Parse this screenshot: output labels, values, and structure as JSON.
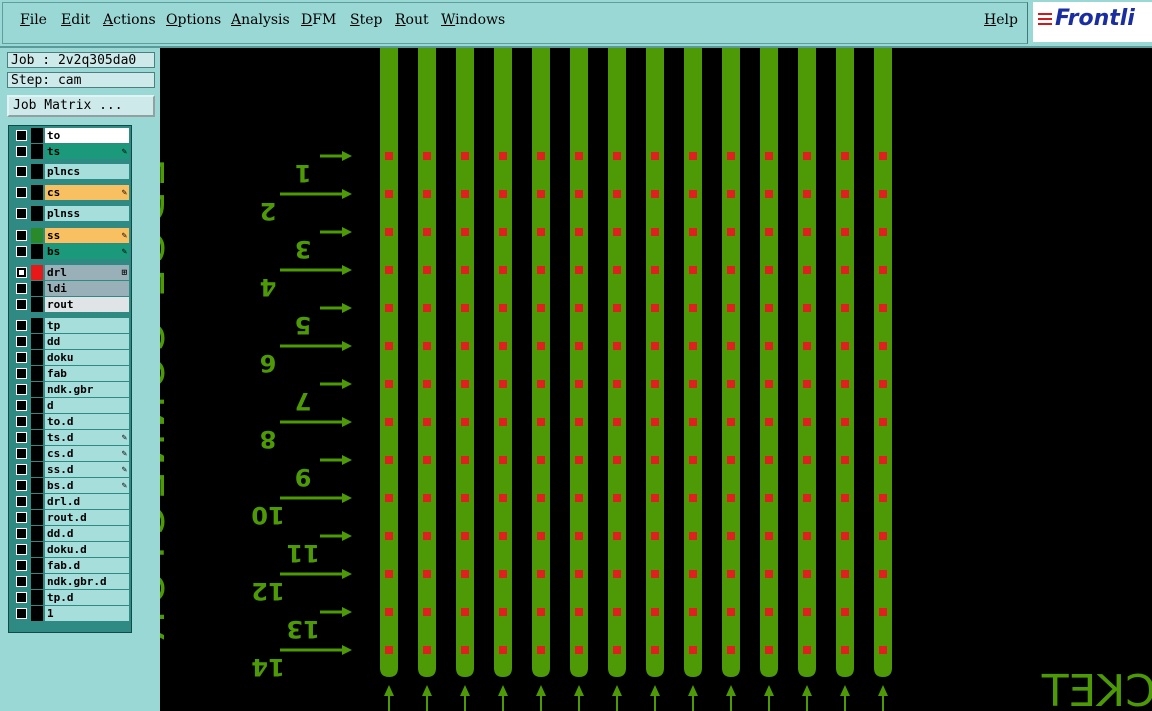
{
  "menu": [
    "File",
    "Edit",
    "Actions",
    "Options",
    "Analysis",
    "DFM",
    "Step",
    "Rout",
    "Windows",
    "Help"
  ],
  "menu_underline": [
    "F",
    "E",
    "A",
    "O",
    "A",
    "D",
    "S",
    "R",
    "W",
    "H"
  ],
  "logo": {
    "text": "Frontli"
  },
  "job": {
    "label": "Job : 2v2q305da0"
  },
  "step": {
    "label": "Step: cam"
  },
  "job_matrix": {
    "label": "Job Matrix ..."
  },
  "layers": [
    {
      "name": "to",
      "color": "#ffffff",
      "swatch": "#000000",
      "mark": ""
    },
    {
      "name": "ts",
      "color": "#1a9a7a",
      "swatch": "#000000",
      "mark": "✎"
    },
    {
      "name": "plncs",
      "color": "#a6dedc",
      "swatch": "#000000",
      "mark": ""
    },
    {
      "name": "cs",
      "color": "#f8c060",
      "swatch": "#000000",
      "mark": "✎"
    },
    {
      "name": "plnss",
      "color": "#a6dedc",
      "swatch": "#000000",
      "mark": ""
    },
    {
      "name": "ss",
      "color": "#f8c060",
      "swatch": "#2a8a2a",
      "mark": "✎"
    },
    {
      "name": "bs",
      "color": "#1a9a7a",
      "swatch": "#000000",
      "mark": "✎"
    },
    {
      "name": "drl",
      "color": "#9ab0b8",
      "swatch": "#e81818",
      "mark": "⊞",
      "selected": true
    },
    {
      "name": "ldi",
      "color": "#9ab0b8",
      "swatch": "#000000",
      "mark": ""
    },
    {
      "name": "rout",
      "color": "#e0e4e6",
      "swatch": "#000000",
      "mark": ""
    },
    {
      "name": "tp",
      "color": "#a6dedc",
      "swatch": "#000000",
      "mark": ""
    },
    {
      "name": "dd",
      "color": "#a6dedc",
      "swatch": "#000000",
      "mark": ""
    },
    {
      "name": "doku",
      "color": "#a6dedc",
      "swatch": "#000000",
      "mark": ""
    },
    {
      "name": "fab",
      "color": "#a6dedc",
      "swatch": "#000000",
      "mark": ""
    },
    {
      "name": "ndk.gbr",
      "color": "#a6dedc",
      "swatch": "#000000",
      "mark": ""
    },
    {
      "name": "d",
      "color": "#a6dedc",
      "swatch": "#000000",
      "mark": ""
    },
    {
      "name": "to.d",
      "color": "#a6dedc",
      "swatch": "#000000",
      "mark": ""
    },
    {
      "name": "ts.d",
      "color": "#a6dedc",
      "swatch": "#000000",
      "mark": "✎"
    },
    {
      "name": "cs.d",
      "color": "#a6dedc",
      "swatch": "#000000",
      "mark": "✎"
    },
    {
      "name": "ss.d",
      "color": "#a6dedc",
      "swatch": "#000000",
      "mark": "✎"
    },
    {
      "name": "bs.d",
      "color": "#a6dedc",
      "swatch": "#000000",
      "mark": "✎"
    },
    {
      "name": "drl.d",
      "color": "#a6dedc",
      "swatch": "#000000",
      "mark": ""
    },
    {
      "name": "rout.d",
      "color": "#a6dedc",
      "swatch": "#000000",
      "mark": ""
    },
    {
      "name": "dd.d",
      "color": "#a6dedc",
      "swatch": "#000000",
      "mark": ""
    },
    {
      "name": "doku.d",
      "color": "#a6dedc",
      "swatch": "#000000",
      "mark": ""
    },
    {
      "name": "fab.d",
      "color": "#a6dedc",
      "swatch": "#000000",
      "mark": ""
    },
    {
      "name": "ndk.gbr.d",
      "color": "#a6dedc",
      "swatch": "#000000",
      "mark": ""
    },
    {
      "name": "tp.d",
      "color": "#a6dedc",
      "swatch": "#000000",
      "mark": ""
    },
    {
      "name": "1",
      "color": "#a6dedc",
      "swatch": "#000000",
      "mark": ""
    }
  ],
  "canvas": {
    "vertical_text": "EDGE CONNECTOR",
    "bottom_text": "CKET",
    "finger_numbers": [
      "1",
      "2",
      "3",
      "4",
      "5",
      "6",
      "7",
      "8",
      "9",
      "10",
      "11",
      "12",
      "13",
      "14"
    ],
    "trace_count": 14,
    "colors": {
      "trace": "#4e9a06",
      "pad": "#e02020",
      "text": "#4e9a06"
    }
  }
}
